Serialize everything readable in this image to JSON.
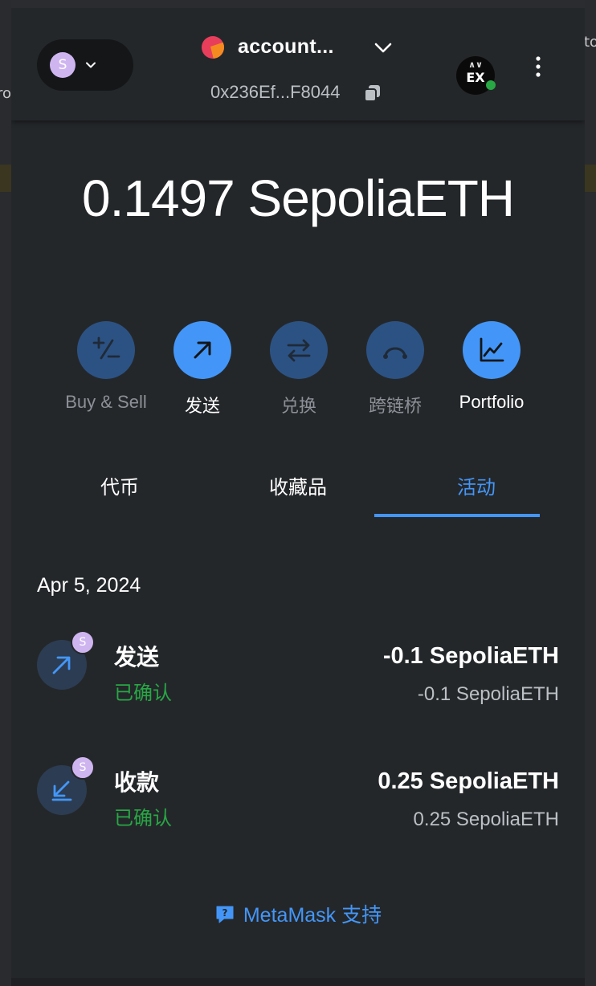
{
  "header": {
    "network_avatar_letter": "S",
    "account_name": "account...",
    "account_address": "0x236Ef...F8044",
    "site_badge_text": "EX"
  },
  "balance": {
    "amount": "0.1497",
    "currency": "SepoliaETH"
  },
  "actions": [
    {
      "label": "Buy & Sell",
      "icon": "plus-minus-icon",
      "state": "disabled"
    },
    {
      "label": "发送",
      "icon": "arrow-up-right-icon",
      "state": "enabled"
    },
    {
      "label": "兑换",
      "icon": "swap-icon",
      "state": "disabled"
    },
    {
      "label": "跨链桥",
      "icon": "bridge-icon",
      "state": "disabled"
    },
    {
      "label": "Portfolio",
      "icon": "chart-icon",
      "state": "enabled"
    }
  ],
  "tabs": [
    {
      "label": "代币",
      "active": false
    },
    {
      "label": "收藏品",
      "active": false
    },
    {
      "label": "活动",
      "active": true
    }
  ],
  "activity": {
    "date": "Apr 5, 2024",
    "items": [
      {
        "title": "发送",
        "status": "已确认",
        "amount": "-0.1 SepoliaETH",
        "amount_secondary": "-0.1 SepoliaETH",
        "badge": "S",
        "icon": "arrow-up-right-icon"
      },
      {
        "title": "收款",
        "status": "已确认",
        "amount": "0.25 SepoliaETH",
        "amount_secondary": "0.25 SepoliaETH",
        "badge": "S",
        "icon": "arrow-down-left-icon"
      }
    ]
  },
  "support": {
    "label": "MetaMask 支持"
  },
  "colors": {
    "accent": "#4396f7",
    "success": "#28a745",
    "background": "#24272a",
    "network_avatar": "#cfb5f0"
  },
  "background_fragments": {
    "left": "ro",
    "right_top": "to"
  }
}
